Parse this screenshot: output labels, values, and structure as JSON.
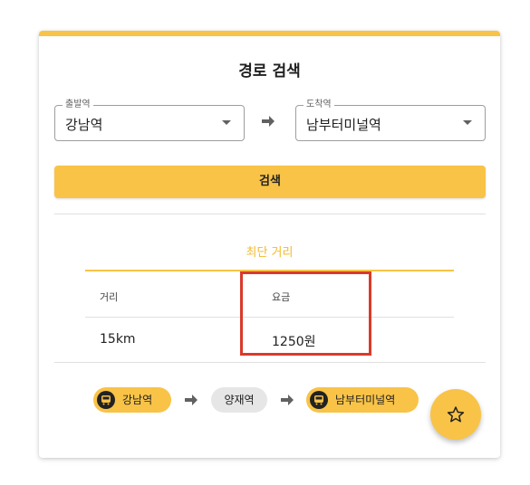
{
  "colors": {
    "accent": "#f8c347",
    "accent_text": "#f4b92a",
    "muted_chip": "#e6e6e6",
    "highlight_box": "#d93a2b"
  },
  "card": {
    "title": "경로 검색"
  },
  "route_form": {
    "from": {
      "legend": "출발역",
      "value": "강남역"
    },
    "to": {
      "legend": "도착역",
      "value": "남부터미널역"
    },
    "search_button": "검색"
  },
  "result": {
    "tab_label": "최단 거리",
    "table": {
      "headers": [
        "거리",
        "요금"
      ],
      "rows": [
        [
          "15km",
          "1250원"
        ]
      ]
    },
    "path": [
      {
        "name": "강남역",
        "icon": "bus-icon",
        "style": "accent"
      },
      {
        "name": "양재역",
        "icon": "",
        "style": "muted"
      },
      {
        "name": "남부터미널역",
        "icon": "bus-icon",
        "style": "accent"
      }
    ]
  },
  "fab": {
    "icon": "star-outline-icon"
  }
}
